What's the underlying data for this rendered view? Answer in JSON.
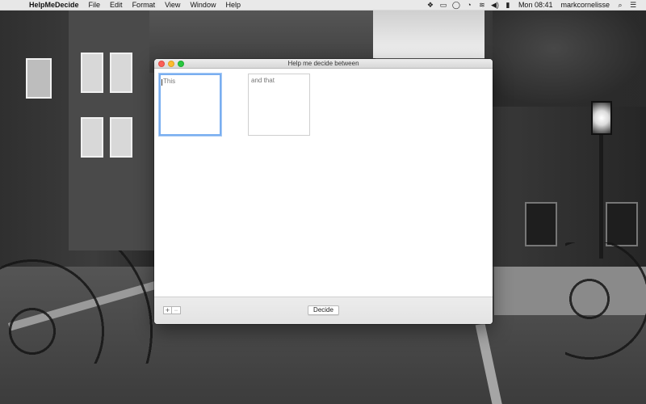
{
  "menubar": {
    "apple": "",
    "items": [
      "HelpMeDecide",
      "File",
      "Edit",
      "Format",
      "View",
      "Window",
      "Help"
    ],
    "status_icons": {
      "dropbox": "❖",
      "airplay": "▭",
      "messages": "◯",
      "time_machine": "◔",
      "wifi": "≋",
      "volume": "◀)",
      "battery": "▮"
    },
    "clock": "Mon 08:41",
    "user": "markcornelisse",
    "search": "⌕",
    "menu_list": "☰"
  },
  "window": {
    "title": "Help me decide between",
    "option_a": {
      "value": "",
      "placeholder": "This"
    },
    "option_b": {
      "value": "",
      "placeholder": "and that"
    },
    "add_label": "+",
    "remove_label": "−",
    "decide_label": "Decide"
  }
}
